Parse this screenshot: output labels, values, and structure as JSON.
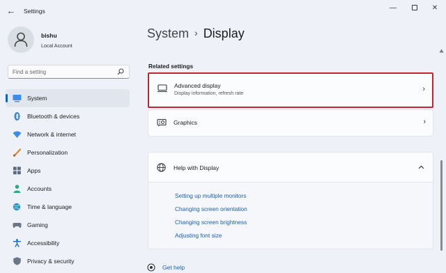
{
  "window": {
    "title": "Settings",
    "back_glyph": "←",
    "min_glyph": "—",
    "close_glyph": "✕"
  },
  "profile": {
    "name": "bishu",
    "account_type": "Local Account"
  },
  "search": {
    "placeholder": "Find a setting"
  },
  "nav": {
    "items": [
      {
        "label": "System",
        "icon": "system-icon",
        "active": true
      },
      {
        "label": "Bluetooth & devices",
        "icon": "bluetooth-icon"
      },
      {
        "label": "Network & internet",
        "icon": "wifi-icon"
      },
      {
        "label": "Personalization",
        "icon": "brush-icon"
      },
      {
        "label": "Apps",
        "icon": "apps-icon"
      },
      {
        "label": "Accounts",
        "icon": "person-icon"
      },
      {
        "label": "Time & language",
        "icon": "globe-clock-icon"
      },
      {
        "label": "Gaming",
        "icon": "gamepad-icon"
      },
      {
        "label": "Accessibility",
        "icon": "accessibility-icon"
      },
      {
        "label": "Privacy & security",
        "icon": "shield-icon"
      }
    ]
  },
  "breadcrumb": {
    "parent": "System",
    "separator": "›",
    "current": "Display"
  },
  "related": {
    "section_title": "Related settings",
    "advanced_display": {
      "title": "Advanced display",
      "subtitle": "Display information, refresh rate",
      "icon": "monitor-icon"
    },
    "graphics": {
      "title": "Graphics",
      "icon": "graphics-card-icon"
    }
  },
  "help": {
    "title": "Help with Display",
    "icon": "globe-icon",
    "links": [
      "Setting up multiple monitors",
      "Changing screen orientation",
      "Changing screen brightness",
      "Adjusting font size"
    ]
  },
  "footer": {
    "get_help": "Get help"
  },
  "colors": {
    "accent": "#0067c0",
    "highlight_border": "#c4242e",
    "link": "#1a5fb4",
    "background": "#eef2f8"
  }
}
